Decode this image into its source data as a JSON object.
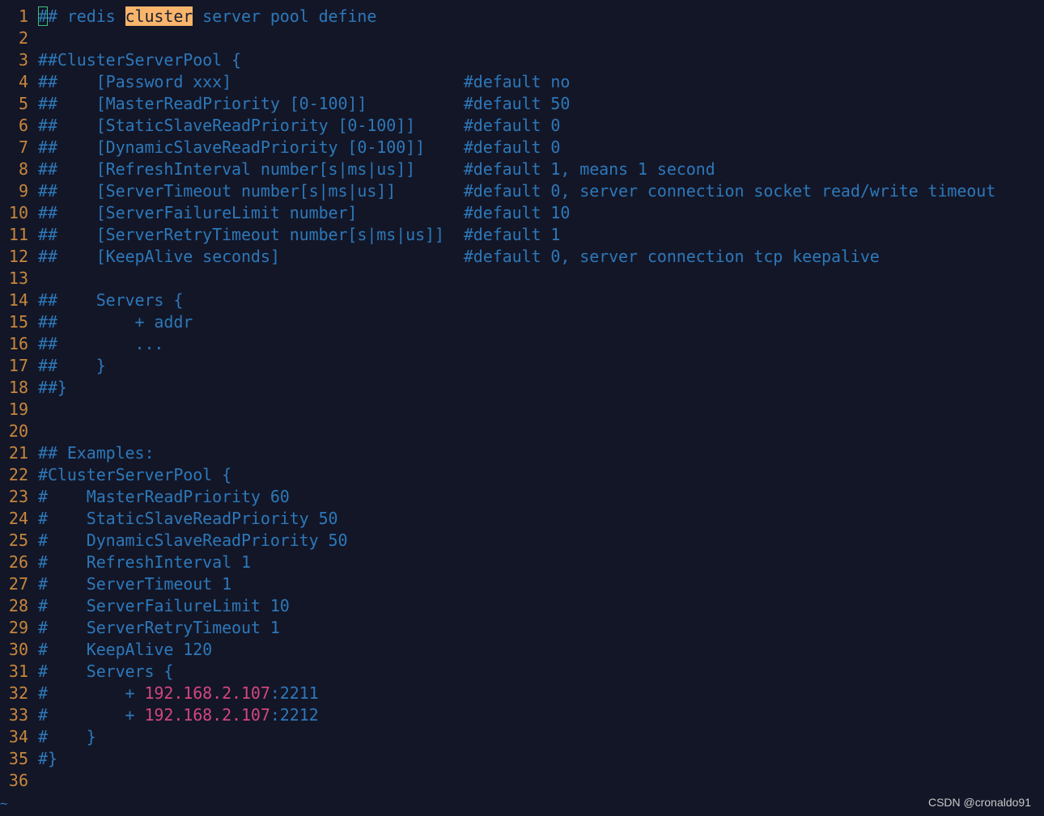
{
  "editor": {
    "lines": [
      {
        "n": "1",
        "parts": [
          {
            "t": "#",
            "c": "cursor"
          },
          {
            "t": "# redis "
          },
          {
            "t": "cluster",
            "c": "search"
          },
          {
            "t": " server pool define"
          }
        ]
      },
      {
        "n": "2",
        "parts": []
      },
      {
        "n": "3",
        "parts": [
          {
            "t": "##ClusterServerPool {"
          }
        ]
      },
      {
        "n": "4",
        "parts": [
          {
            "t": "##    [Password xxx]                        #default no"
          }
        ]
      },
      {
        "n": "5",
        "parts": [
          {
            "t": "##    [MasterReadPriority [0-100]]          #default 50"
          }
        ]
      },
      {
        "n": "6",
        "parts": [
          {
            "t": "##    [StaticSlaveReadPriority [0-100]]     #default 0"
          }
        ]
      },
      {
        "n": "7",
        "parts": [
          {
            "t": "##    [DynamicSlaveReadPriority [0-100]]    #default 0"
          }
        ]
      },
      {
        "n": "8",
        "parts": [
          {
            "t": "##    [RefreshInterval number[s|ms|us]]     #default 1, means 1 second"
          }
        ]
      },
      {
        "n": "9",
        "parts": [
          {
            "t": "##    [ServerTimeout number[s|ms|us]]       #default 0, server connection socket read/write timeout"
          }
        ]
      },
      {
        "n": "10",
        "parts": [
          {
            "t": "##    [ServerFailureLimit number]           #default 10"
          }
        ]
      },
      {
        "n": "11",
        "parts": [
          {
            "t": "##    [ServerRetryTimeout number[s|ms|us]]  #default 1"
          }
        ]
      },
      {
        "n": "12",
        "parts": [
          {
            "t": "##    [KeepAlive seconds]                   #default 0, server connection tcp keepalive"
          }
        ]
      },
      {
        "n": "13",
        "parts": []
      },
      {
        "n": "14",
        "parts": [
          {
            "t": "##    Servers {"
          }
        ]
      },
      {
        "n": "15",
        "parts": [
          {
            "t": "##        + addr"
          }
        ]
      },
      {
        "n": "16",
        "parts": [
          {
            "t": "##        ..."
          }
        ]
      },
      {
        "n": "17",
        "parts": [
          {
            "t": "##    }"
          }
        ]
      },
      {
        "n": "18",
        "parts": [
          {
            "t": "##}"
          }
        ]
      },
      {
        "n": "19",
        "parts": []
      },
      {
        "n": "20",
        "parts": []
      },
      {
        "n": "21",
        "parts": [
          {
            "t": "## Examples:"
          }
        ]
      },
      {
        "n": "22",
        "parts": [
          {
            "t": "#ClusterServerPool {"
          }
        ]
      },
      {
        "n": "23",
        "parts": [
          {
            "t": "#    MasterReadPriority 60"
          }
        ]
      },
      {
        "n": "24",
        "parts": [
          {
            "t": "#    StaticSlaveReadPriority 50"
          }
        ]
      },
      {
        "n": "25",
        "parts": [
          {
            "t": "#    DynamicSlaveReadPriority 50"
          }
        ]
      },
      {
        "n": "26",
        "parts": [
          {
            "t": "#    RefreshInterval 1"
          }
        ]
      },
      {
        "n": "27",
        "parts": [
          {
            "t": "#    ServerTimeout 1"
          }
        ]
      },
      {
        "n": "28",
        "parts": [
          {
            "t": "#    ServerFailureLimit 10"
          }
        ]
      },
      {
        "n": "29",
        "parts": [
          {
            "t": "#    ServerRetryTimeout 1"
          }
        ]
      },
      {
        "n": "30",
        "parts": [
          {
            "t": "#    KeepAlive 120"
          }
        ]
      },
      {
        "n": "31",
        "parts": [
          {
            "t": "#    Servers {"
          }
        ]
      },
      {
        "n": "32",
        "parts": [
          {
            "t": "#        + "
          },
          {
            "t": "192.168.2.107",
            "c": "ip"
          },
          {
            "t": ":2211"
          }
        ]
      },
      {
        "n": "33",
        "parts": [
          {
            "t": "#        + "
          },
          {
            "t": "192.168.2.107",
            "c": "ip"
          },
          {
            "t": ":2212"
          }
        ]
      },
      {
        "n": "34",
        "parts": [
          {
            "t": "#    }"
          }
        ]
      },
      {
        "n": "35",
        "parts": [
          {
            "t": "#}"
          }
        ]
      },
      {
        "n": "36",
        "parts": []
      }
    ],
    "tilde": "~"
  },
  "watermark": "CSDN @cronaldo91",
  "colors": {
    "background": "#131627",
    "line_number": "#c7873c",
    "comment": "#2d78b9",
    "search_highlight": "#f9b56c",
    "ip_address": "#d2467f",
    "cursor": "#3fbf7f"
  }
}
